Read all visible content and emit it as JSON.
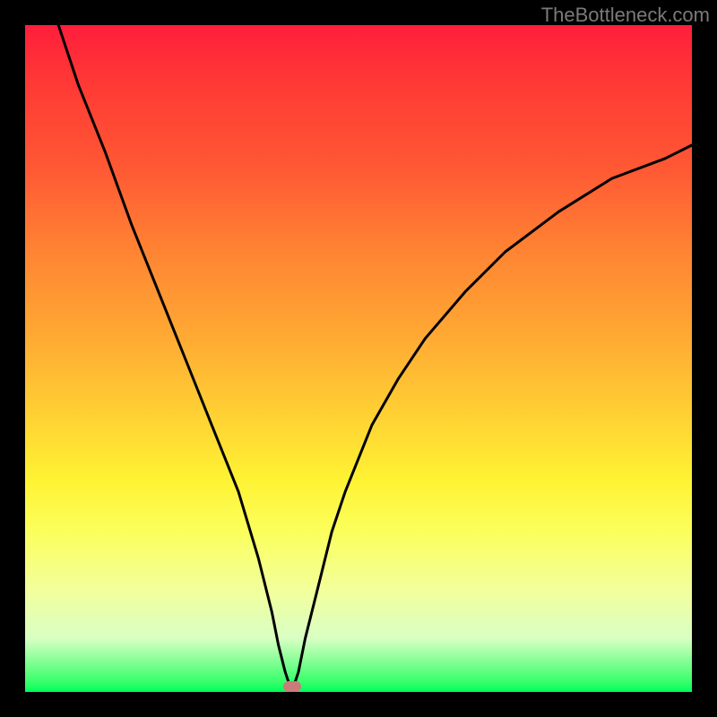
{
  "watermark": "TheBottleneck.com",
  "chart_data": {
    "type": "line",
    "title": "",
    "xlabel": "",
    "ylabel": "",
    "xlim": [
      0,
      100
    ],
    "ylim": [
      0,
      100
    ],
    "grid": false,
    "legend": false,
    "background": "rainbow-gradient-red-to-green",
    "series": [
      {
        "name": "bottleneck-curve",
        "color": "#000000",
        "x": [
          5,
          8,
          12,
          16,
          20,
          24,
          28,
          32,
          35,
          37,
          38,
          39,
          40,
          41,
          42,
          44,
          46,
          48,
          52,
          56,
          60,
          66,
          72,
          80,
          88,
          96,
          100
        ],
        "y": [
          100,
          91,
          81,
          70,
          60,
          50,
          40,
          30,
          20,
          12,
          7,
          3,
          0,
          3,
          8,
          16,
          24,
          30,
          40,
          47,
          53,
          60,
          66,
          72,
          77,
          80,
          82
        ]
      }
    ],
    "marker": {
      "x": 40,
      "y": 0,
      "color": "#c97c7c",
      "shape": "rounded-rect"
    },
    "minimum_at_x_percent": 40
  }
}
